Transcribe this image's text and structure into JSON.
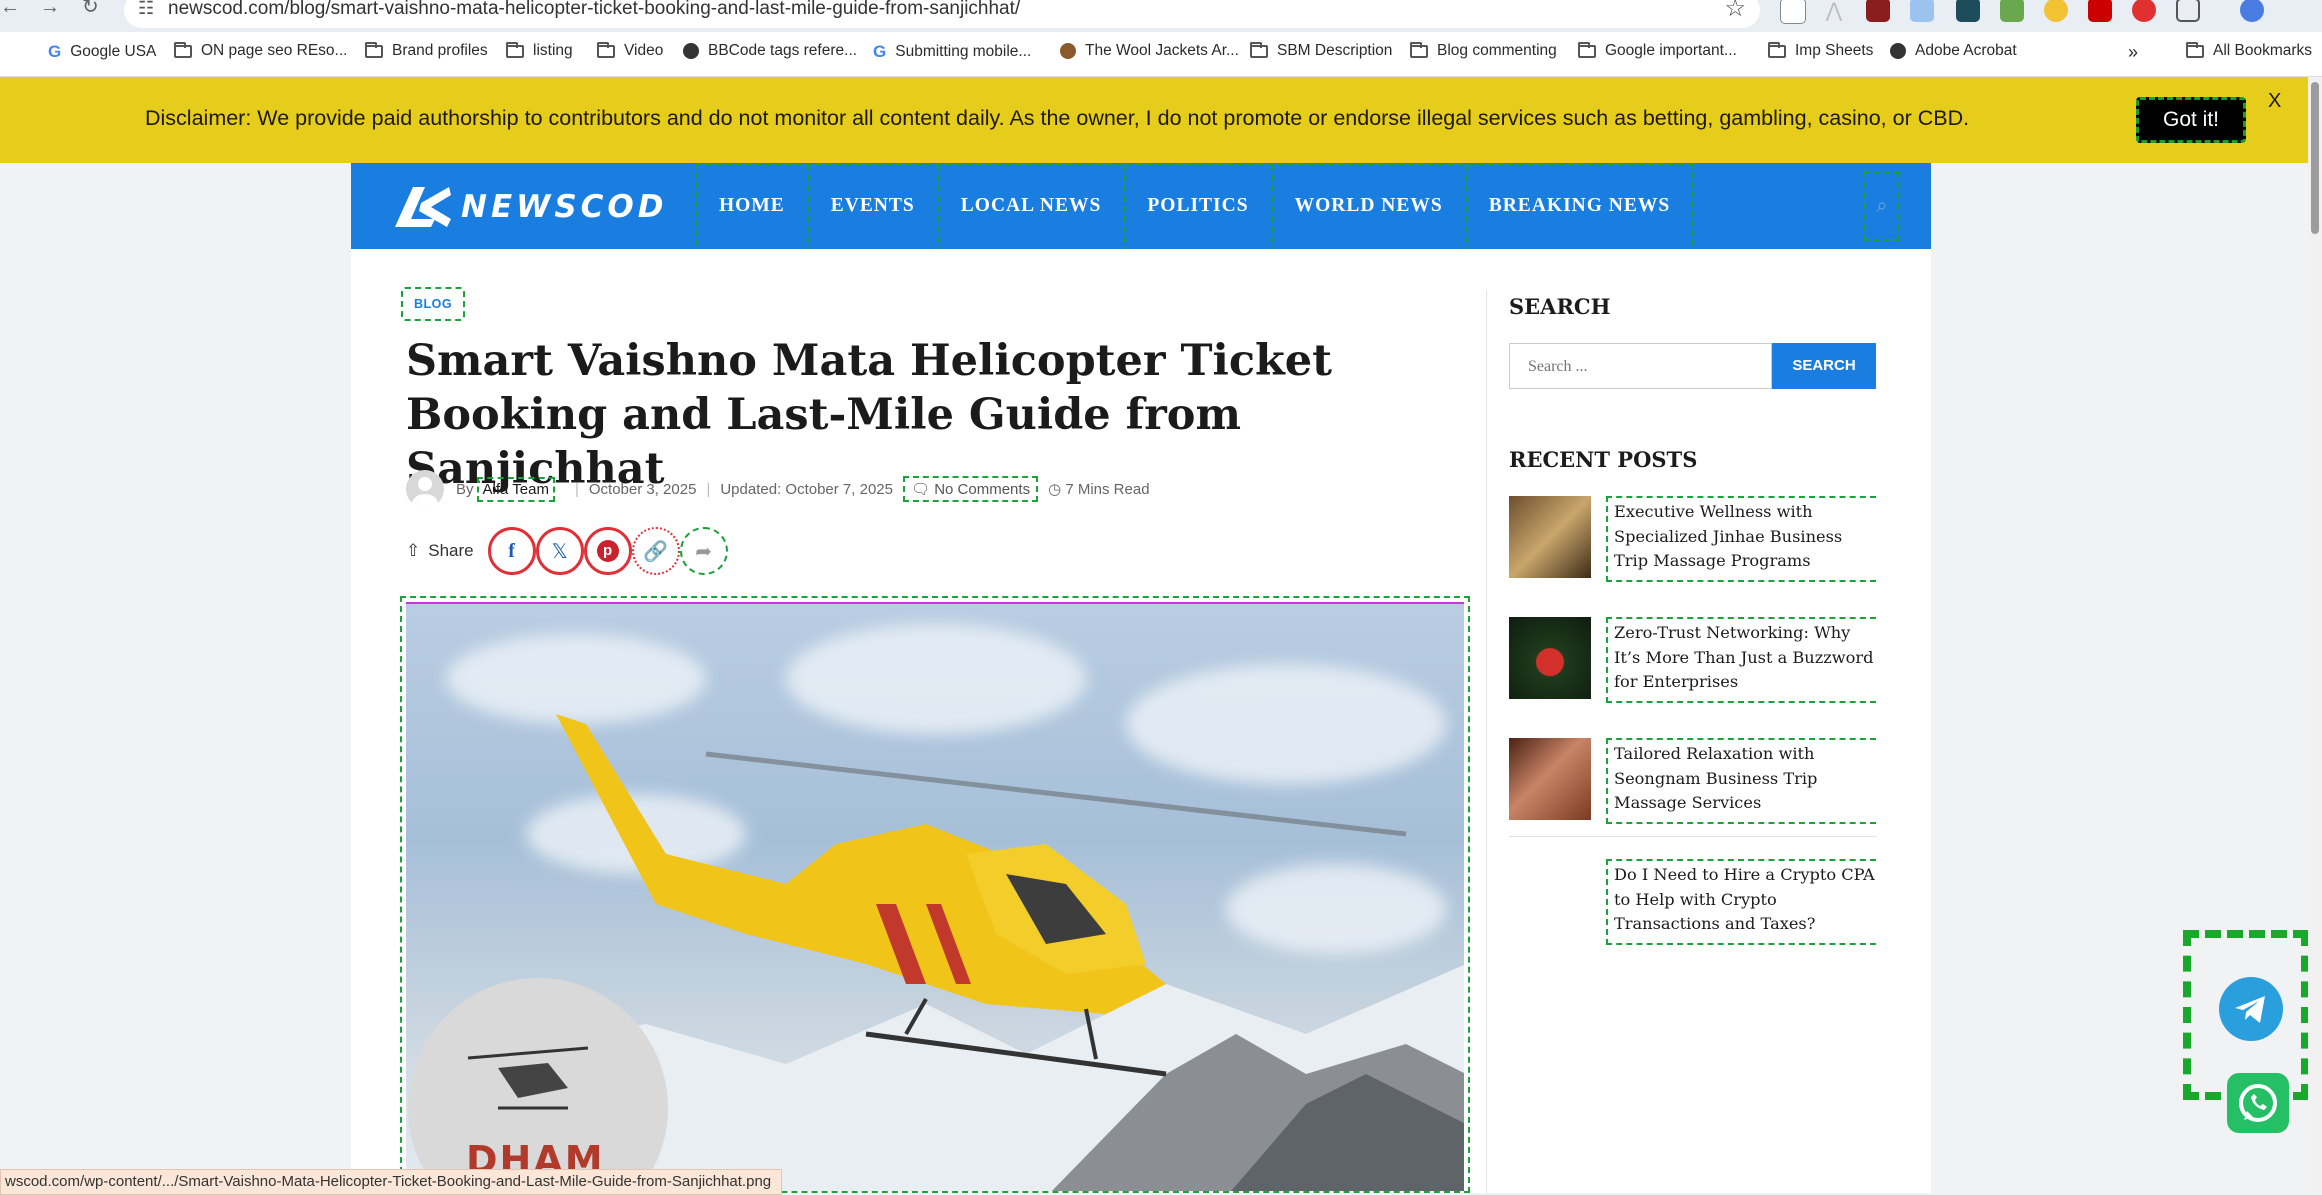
{
  "browser": {
    "url": "newscod.com/blog/smart-vaishno-mata-helicopter-ticket-booking-and-last-mile-guide-from-sanjichhat/",
    "bookmarks": [
      {
        "label": "Google USA",
        "icon": "google-icon"
      },
      {
        "label": "ON page seo REso...",
        "icon": "folder-icon"
      },
      {
        "label": "Brand profiles",
        "icon": "folder-icon"
      },
      {
        "label": "listing",
        "icon": "folder-icon"
      },
      {
        "label": "Video",
        "icon": "folder-icon"
      },
      {
        "label": "BBCode tags refere...",
        "icon": "globe-icon"
      },
      {
        "label": "Submitting mobile...",
        "icon": "google-icon"
      },
      {
        "label": "The Wool Jackets Ar...",
        "icon": "site-icon"
      },
      {
        "label": "SBM Description",
        "icon": "folder-icon"
      },
      {
        "label": "Blog commenting",
        "icon": "folder-icon"
      },
      {
        "label": "Google important...",
        "icon": "folder-icon"
      },
      {
        "label": "Imp Sheets",
        "icon": "folder-icon"
      },
      {
        "label": "Adobe Acrobat",
        "icon": "globe-icon"
      }
    ],
    "more_bookmarks": "»",
    "all_bookmarks": "All Bookmarks",
    "status_url": "wscod.com/wp-content/.../Smart-Vaishno-Mata-Helicopter-Ticket-Booking-and-Last-Mile-Guide-from-Sanjichhat.png"
  },
  "disclaimer": {
    "text": "Disclaimer: We provide paid authorship to contributors and do not monitor all content daily. As the owner, I do not promote or endorse illegal services such as betting, gambling, casino, or CBD.",
    "button": "Got it!",
    "close": "X"
  },
  "site": {
    "logo": "NEWSCOD",
    "menu": [
      "HOME",
      "EVENTS",
      "LOCAL NEWS",
      "POLITICS",
      "WORLD NEWS",
      "BREAKING NEWS"
    ],
    "brand_color": "#1a7de0"
  },
  "article": {
    "category": "BLOG",
    "title": "Smart Vaishno Mata Helicopter Ticket Booking and Last-Mile Guide from Sanjichhat",
    "by": "By",
    "author": "Alfa Team",
    "date": "October 3, 2025",
    "updated_label": "Updated:",
    "updated": "October 7, 2025",
    "comments": "No Comments",
    "read_time": "7 Mins Read",
    "share_label": "Share",
    "image_badge_text": "DHAM"
  },
  "sidebar": {
    "search_title": "SEARCH",
    "search_placeholder": "Search ...",
    "search_button": "SEARCH",
    "recent_title": "RECENT POSTS",
    "recent_posts": [
      {
        "title": "Executive Wellness with Specialized Jinhae Business Trip Massage Programs"
      },
      {
        "title": "Zero-Trust Networking: Why It’s More Than Just a Buzzword for Enterprises"
      },
      {
        "title": "Tailored Relaxation with Seongnam Business Trip Massage Services"
      },
      {
        "title": "Do I Need to Hire a Crypto CPA to Help with Crypto Transactions and Taxes?"
      }
    ]
  }
}
